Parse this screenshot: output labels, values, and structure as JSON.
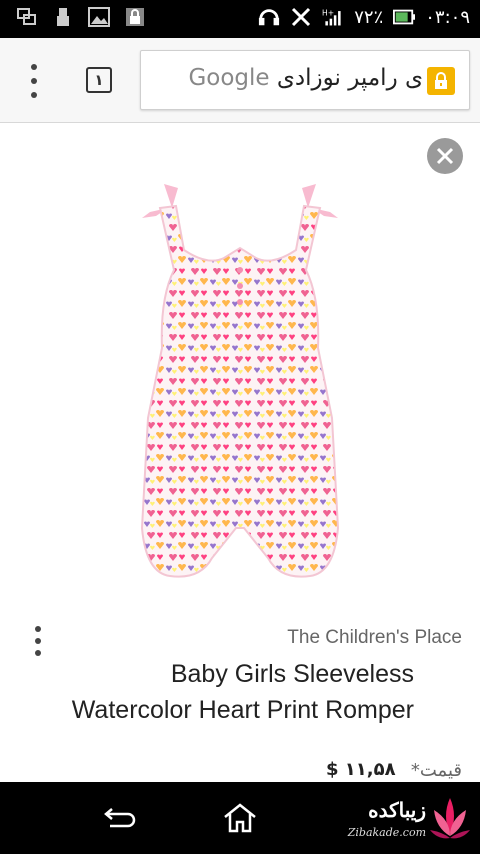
{
  "status_bar": {
    "battery_percent": "۷۲٪",
    "time": "۰۳:۰۹",
    "network": "H+"
  },
  "toolbar": {
    "tab_count": "۱",
    "omnibox_query": "ی رامپر نوزادی",
    "omnibox_suffix": "Google",
    "lock_color": "#f4b400"
  },
  "product": {
    "merchant": "The Children's Place",
    "title_line1": "Baby Girls Sleeveless",
    "title_line2": "Watercolor Heart Print Romper",
    "price_label": "قیمت*",
    "price_value": "$ ۱۱,۵۸"
  },
  "watermark": {
    "text": "زیباکده",
    "sub": "Zibakade.com"
  }
}
